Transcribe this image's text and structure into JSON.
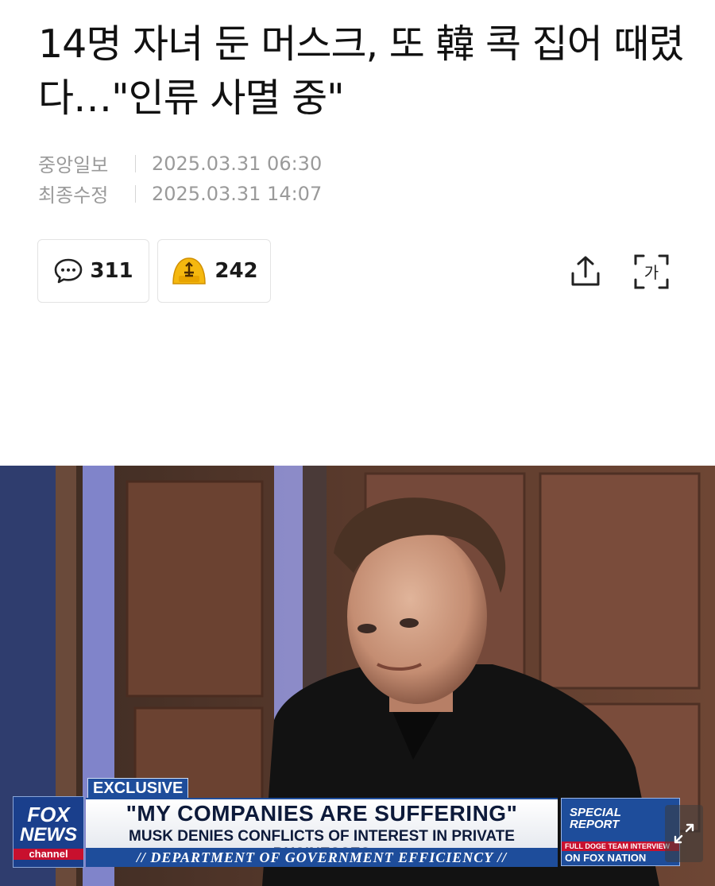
{
  "article": {
    "headline": "14명 자녀 둔 머스크, 또 韓 콕 집어 때렸다…\"인류 사멸 중\"",
    "publisher": "중앙일보",
    "published_at": "2025.03.31 06:30",
    "updated_label": "최종수정",
    "updated_at": "2025.03.31 14:07"
  },
  "actions": {
    "comment_count": "311",
    "reaction_count": "242",
    "share_icon": "share-icon",
    "font_icon": "font-size-icon",
    "font_icon_label": "가"
  },
  "photo": {
    "chyron": {
      "exclusive": "EXCLUSIVE",
      "headline": "\"MY COMPANIES ARE SUFFERING\"",
      "subline": "MUSK DENIES CONFLICTS OF INTEREST IN PRIVATE BUSINESSES",
      "department": "// DEPARTMENT OF GOVERNMENT EFFICIENCY //",
      "logo_line1": "FOX",
      "logo_line2": "NEWS",
      "logo_line3": "channel",
      "special_line1": "SPECIAL",
      "special_line2": "REPORT",
      "full_interview": "FULL DOGE TEAM INTERVIEW",
      "on_nation": "ON FOX NATION"
    },
    "expand_icon": "expand-icon"
  },
  "colors": {
    "accent": "#1e4d9b",
    "meta_gray": "#9a9a9a",
    "reaction_yellow": "#f5b80f"
  }
}
